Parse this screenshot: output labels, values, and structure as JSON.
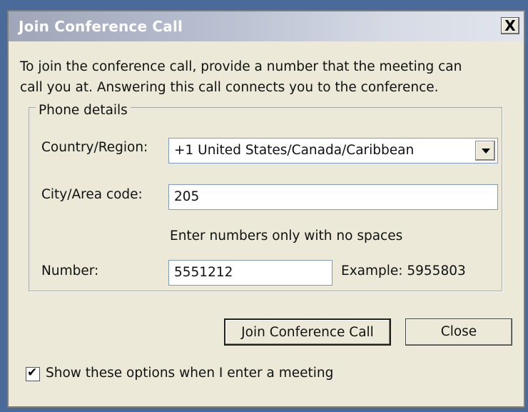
{
  "window": {
    "title": "Join Conference Call",
    "close_glyph": "X"
  },
  "intro": {
    "line1": "To join the conference call, provide a number that the meeting can",
    "line2": "call you at.  Answering this call connects you to the conference."
  },
  "phone_details": {
    "group_label": "Phone details",
    "country_label": "Country/Region:",
    "country_value": "+1  United States/Canada/Caribbean",
    "city_label": "City/Area code:",
    "city_value": "205",
    "hint": "Enter numbers only with no spaces",
    "number_label": "Number:",
    "number_value": "5551212",
    "example": "Example: 5955803"
  },
  "buttons": {
    "join": "Join Conference Call",
    "close": "Close"
  },
  "options": {
    "show_options_label": "Show these options when I enter a meeting",
    "show_options_checked": true
  },
  "colors": {
    "dialog_bg": "#ece9d8",
    "title_bar": "#b7bfd0",
    "input_border": "#7f9db9"
  },
  "icons": {
    "close": "close-icon",
    "dropdown": "chevron-down-icon",
    "checkbox": "checkmark-icon"
  }
}
